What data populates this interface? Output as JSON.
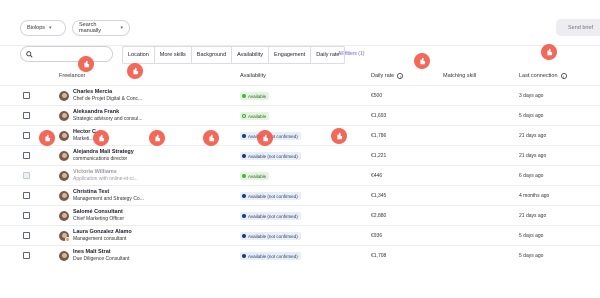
{
  "topbar": {
    "dropdowns": [
      {
        "label": "Biolops",
        "id": "dd1"
      },
      {
        "label": "Search manually",
        "id": "dd2"
      }
    ],
    "send_button": "Send brief"
  },
  "filters": {
    "search_placeholder": "",
    "buttons": [
      "Location",
      "More skills",
      "Background",
      "Availability",
      "Engagement",
      "Daily rate"
    ],
    "link": "All filters (1)"
  },
  "table": {
    "headers": {
      "freelancer": "Freelancer",
      "availability": "Availability",
      "daily_rate": "Daily rate",
      "matching_skill": "Matching skill",
      "last_connection": "Last connection"
    },
    "rows": [
      {
        "name": "Charles Mercia",
        "title": "Chef de Projet Digital & Conc...",
        "availability": "Available",
        "status": "green",
        "rate": "€500",
        "last": "3 days ago",
        "faded": false
      },
      {
        "name": "Aleksandra Frank",
        "title": "Strategic advisory and consul...",
        "availability": "Available",
        "status": "green-outline",
        "rate": "€1,693",
        "last": "5 days ago",
        "faded": false
      },
      {
        "name": "Hector C...",
        "title": "Marketi...",
        "availability": "Available (not confirmed)",
        "status": "blue",
        "rate": "€1,786",
        "last": "21 days ago",
        "faded": false
      },
      {
        "name": "Alejandra Mali Strategy",
        "title": "communications director",
        "availability": "Available (not confirmed)",
        "status": "blue",
        "rate": "€1,221",
        "last": "21 days ago",
        "faded": false
      },
      {
        "name": "Victoria Williams",
        "title": "Application with online-et-ci...",
        "availability": "Available",
        "status": "green",
        "rate": "€446",
        "last": "6 days ago",
        "faded": true
      },
      {
        "name": "Christina Test",
        "title": "Management and Strategy Co...",
        "availability": "Available (not confirmed)",
        "status": "blue",
        "rate": "€1,345",
        "last": "4 months ago",
        "faded": false
      },
      {
        "name": "Salomé Consultant",
        "title": "Chief Marketing Officer",
        "availability": "Available (not confirmed)",
        "status": "blue",
        "rate": "€2,880",
        "last": "21 days ago",
        "faded": false
      },
      {
        "name": "Laura Gonzalez Alamo",
        "title": "Management consultant",
        "availability": "Available (not confirmed)",
        "status": "blue",
        "rate": "€936",
        "last": "5 days ago",
        "faded": false
      },
      {
        "name": "Ines Malt Strat",
        "title": "Due Diligence Consultant",
        "availability": "Available (not confirmed)",
        "status": "blue",
        "rate": "€1,708",
        "last": "5 days ago",
        "faded": false
      }
    ]
  },
  "colors": {
    "accent": "#6b59d3",
    "marker": "#f25c4c",
    "available": "#4bb33f",
    "unconfirmed": "#1e3e6c"
  },
  "icons": {
    "search": "search-icon",
    "info": "info-icon",
    "marker": "hand-pointer-icon"
  }
}
